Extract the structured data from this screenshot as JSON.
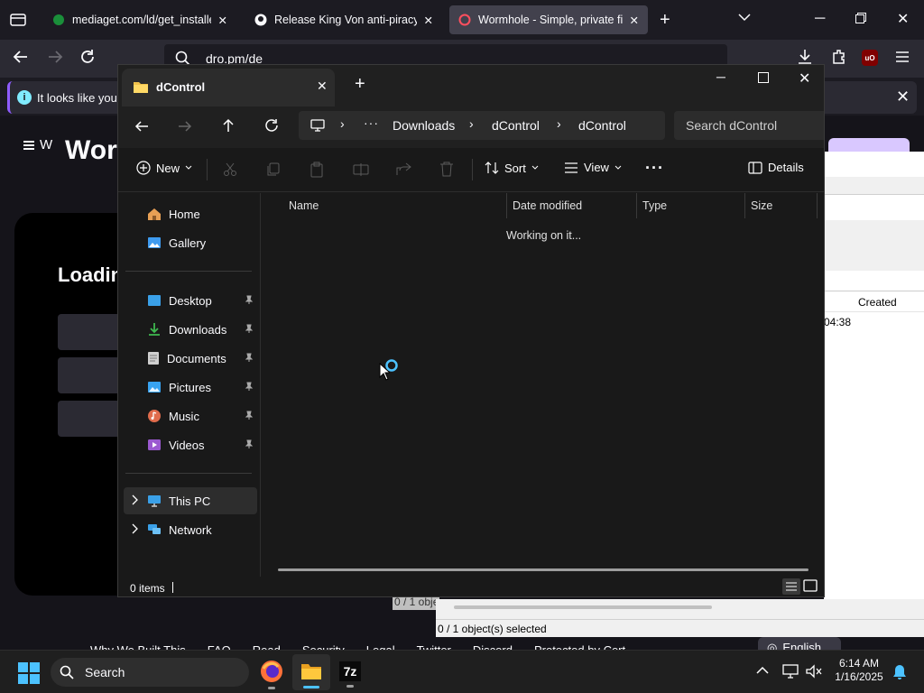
{
  "browser": {
    "tabs": [
      {
        "title": "mediaget.com/ld/get_installer..."
      },
      {
        "title": "Release King Von anti-piracy sc..."
      },
      {
        "title": "Wormhole - Simple, private file..."
      }
    ],
    "url": "dro.pm/de",
    "notice_text": "It looks like you h"
  },
  "website": {
    "logo_text": "W",
    "title": "Wor",
    "loading": "Loadin",
    "footer_links": [
      "Why We Built This",
      "FAQ",
      "Read",
      "Security",
      "Legal",
      "Twitter",
      "Discord",
      "Protected by Cert"
    ],
    "lang_button": "English"
  },
  "sevenzip_window": {
    "column_created": "Created",
    "time_fragment": "04:38",
    "status": "0 / 1 object(s) selected",
    "status_fragment": "0 / 1 obje"
  },
  "explorer": {
    "tab_title": "dControl",
    "breadcrumb": [
      "Downloads",
      "dControl",
      "dControl"
    ],
    "search_placeholder": "Search dControl",
    "toolbar": {
      "new": "New",
      "sort": "Sort",
      "view": "View",
      "details": "Details"
    },
    "nav": {
      "home": "Home",
      "gallery": "Gallery",
      "desktop": "Desktop",
      "downloads": "Downloads",
      "documents": "Documents",
      "pictures": "Pictures",
      "music": "Music",
      "videos": "Videos",
      "thispc": "This PC",
      "network": "Network"
    },
    "columns": {
      "name": "Name",
      "date": "Date modified",
      "type": "Type",
      "size": "Size"
    },
    "working": "Working on it...",
    "status": "0 items"
  },
  "taskbar": {
    "search": "Search",
    "time": "6:14 AM",
    "date": "1/16/2025"
  },
  "colors": {
    "accent": "#0078d4",
    "firefox_active_tab_icon": "#ff4f5e",
    "ublock": "#800000"
  }
}
